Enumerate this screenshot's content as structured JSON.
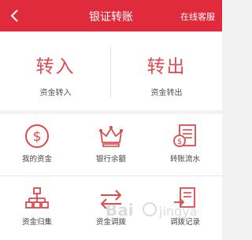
{
  "header": {
    "title": "银证转账",
    "service_label": "在线客服",
    "back_icon": "chevron-left-icon"
  },
  "transfer": {
    "in": {
      "title": "转入",
      "subtitle": "资金转入"
    },
    "out": {
      "title": "转出",
      "subtitle": "资金转出"
    }
  },
  "grid": {
    "items": [
      {
        "label": "我的资金",
        "icon": "dollar-circle-icon"
      },
      {
        "label": "银行余额",
        "icon": "crown-icon"
      },
      {
        "label": "转账流水",
        "icon": "statement-icon"
      },
      {
        "label": "资金归集",
        "icon": "hierarchy-icon"
      },
      {
        "label": "资金调拨",
        "icon": "swap-arrows-icon"
      },
      {
        "label": "调拨记录",
        "icon": "transfer-record-icon"
      }
    ]
  },
  "colors": {
    "primary": "#e02b3d",
    "accent": "#e04a50"
  }
}
